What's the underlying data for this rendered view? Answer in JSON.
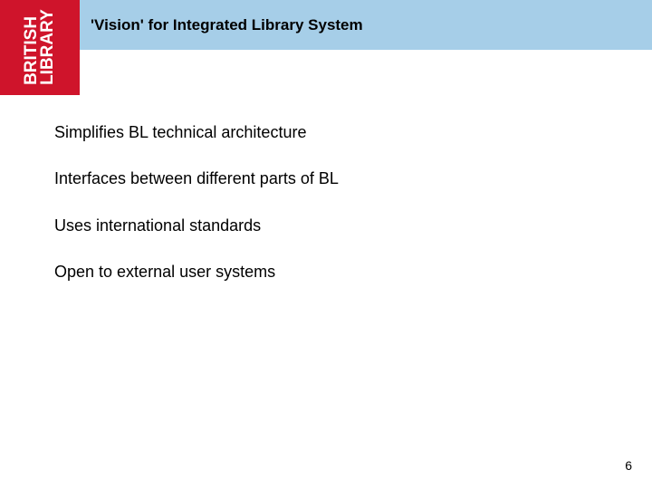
{
  "header": {
    "title": "'Vision' for Integrated Library System"
  },
  "logo": {
    "line1": "BRITISH",
    "line2": "LIBRARY"
  },
  "bullets": [
    "Simplifies BL technical architecture",
    "Interfaces between different parts of BL",
    "Uses international standards",
    "Open to external user systems"
  ],
  "page_number": "6"
}
